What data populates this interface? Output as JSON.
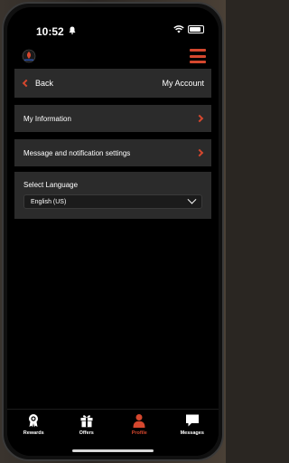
{
  "status_bar": {
    "time": "10:52"
  },
  "nav": {
    "back_label": "Back",
    "title": "My Account"
  },
  "menu_rows": [
    {
      "label": "My Information"
    },
    {
      "label": "Message and notification settings"
    }
  ],
  "language": {
    "label": "Select Language",
    "selected": "English (US)"
  },
  "tabs": [
    {
      "label": "Rewards",
      "icon": "rewards-medal-icon",
      "active": false
    },
    {
      "label": "Offers",
      "icon": "gift-icon",
      "active": false
    },
    {
      "label": "Profile",
      "icon": "person-icon",
      "active": true
    },
    {
      "label": "Messages",
      "icon": "chat-bubble-icon",
      "active": false
    }
  ],
  "colors": {
    "accent": "#d5472e",
    "card": "#2b2b2b",
    "background": "#000000"
  }
}
